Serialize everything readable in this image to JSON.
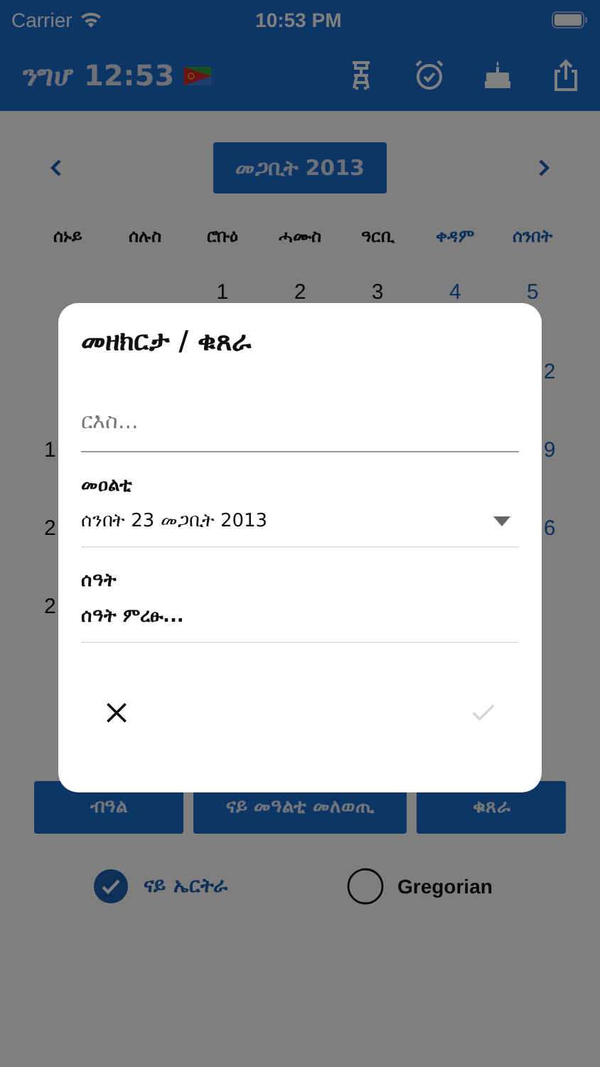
{
  "status_bar": {
    "carrier": "Carrier",
    "time": "10:53 PM"
  },
  "header": {
    "title": "ንግሆ 12:53"
  },
  "calendar": {
    "month": "መጋቢት 2013",
    "weekdays": [
      {
        "label": "ሰኑይ",
        "weekend": false
      },
      {
        "label": "ሰሉስ",
        "weekend": false
      },
      {
        "label": "ሮቡዕ",
        "weekend": false
      },
      {
        "label": "ሓሙስ",
        "weekend": false
      },
      {
        "label": "ዓርቢ",
        "weekend": false
      },
      {
        "label": "ቀዳም",
        "weekend": true
      },
      {
        "label": "ሰንበት",
        "weekend": true
      }
    ],
    "rows": [
      [
        null,
        null,
        "1",
        "2",
        "3",
        "4",
        "5"
      ],
      [
        null,
        null,
        null,
        null,
        null,
        null,
        "2"
      ],
      [
        "1",
        null,
        null,
        null,
        null,
        null,
        "9"
      ],
      [
        "2",
        null,
        null,
        null,
        null,
        null,
        "6"
      ],
      [
        "2",
        null,
        null,
        null,
        null,
        null,
        null
      ]
    ]
  },
  "buttons": [
    "ብዓል",
    "ናይ መዓልቲ መለወጢ",
    "ቁጸራ"
  ],
  "calendar_types": [
    {
      "label": "ናይ ኤርትራ",
      "selected": true
    },
    {
      "label": "Gregorian",
      "selected": false
    }
  ],
  "dialog": {
    "title": "መዘክርታ / ቁጸራ",
    "title_field": {
      "placeholder": "ርእስ..."
    },
    "date_label": "መዐልቲ",
    "date_value": "ሰንበት 23 መጋቢት 2013",
    "time_label": "ሰዓት",
    "time_value": "ሰዓት ምረፁ...",
    "confirm": {
      "disabled": true
    }
  }
}
